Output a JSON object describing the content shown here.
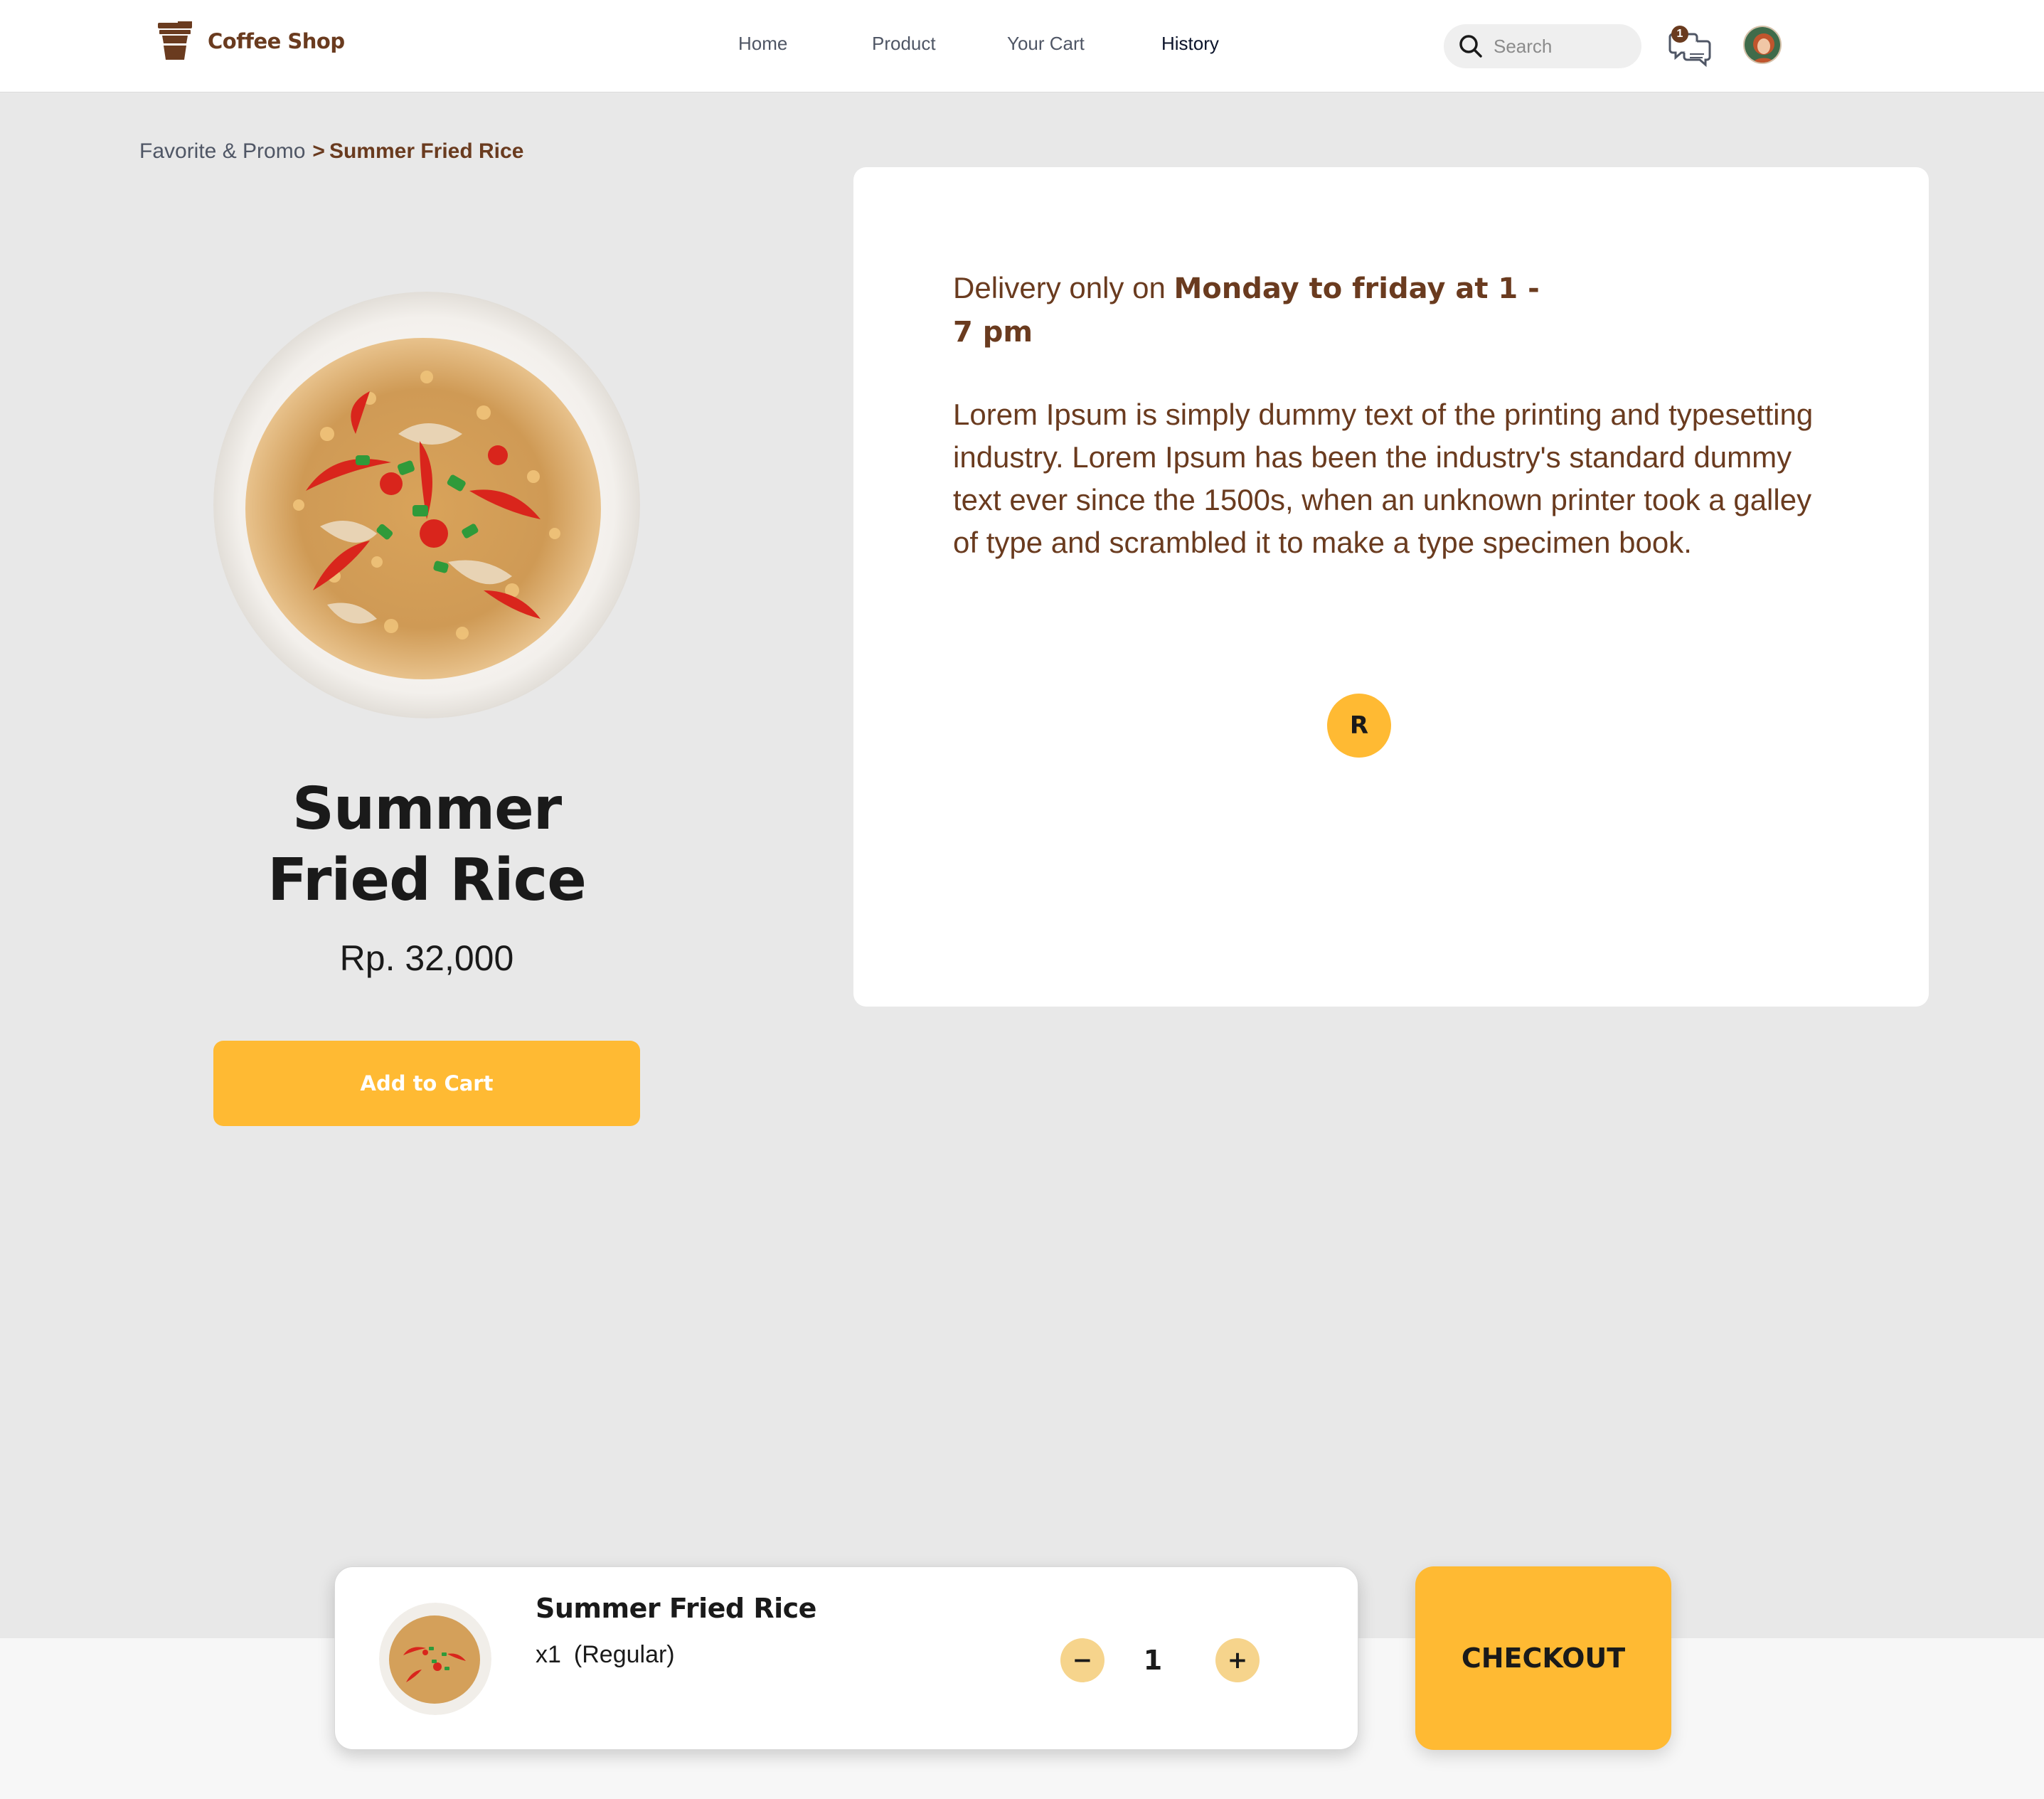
{
  "navbar": {
    "brand": "Coffee Shop",
    "links": [
      {
        "label": "Home"
      },
      {
        "label": "Product"
      },
      {
        "label": "Your Cart"
      },
      {
        "label": "History"
      }
    ],
    "active_link": "History",
    "search_placeholder": "Search",
    "chat_badge_count": "1",
    "icons": {
      "brand": "coffee-cup-icon",
      "search": "search-icon",
      "chat": "chat-icon",
      "avatar": "user-avatar"
    }
  },
  "breadcrumb": {
    "parent": "Favorite & Promo",
    "separator": ">",
    "current": "Summer Fried Rice"
  },
  "product": {
    "name": "Summer Fried Rice",
    "price": "Rp. 32,000",
    "add_to_cart_label": "Add to Cart"
  },
  "details": {
    "delivery_prefix": "Delivery only on ",
    "delivery_bold": "Monday to friday at 1 - 7 pm",
    "description": "Lorem Ipsum is simply dummy text of the printing and typesetting industry. Lorem Ipsum has been the industry's standard dummy text ever since the 1500s, when an unknown printer took a galley of type and scrambled it to make a type specimen book.",
    "size_option": "R"
  },
  "cart_summary": {
    "item_name": "Summer Fried Rice",
    "quantity_label": "x1",
    "size_label": "(Regular)",
    "qty_minus": "−",
    "qty_value": "1",
    "qty_plus": "+"
  },
  "checkout_label": "CHECKOUT",
  "colors": {
    "brand_brown": "#6a3b1f",
    "accent_yellow": "#ffba33",
    "qty_button": "#f6d48c",
    "page_bg": "#e8e8e8"
  }
}
